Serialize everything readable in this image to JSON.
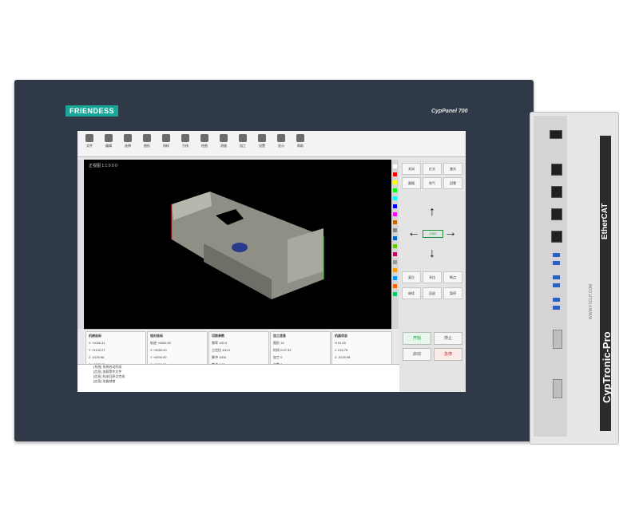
{
  "brand": "FRIENDESS",
  "model": "CypPanel 700",
  "toolbar": {
    "items": [
      "文件",
      "编辑",
      "选择",
      "图形",
      "排样",
      "引线",
      "绘图",
      "测量",
      "加工",
      "设置",
      "显示",
      "帮助"
    ]
  },
  "viewport": {
    "label": "正视图 1:1 0 0 0"
  },
  "right_panel": {
    "top": [
      "关闭",
      "红光",
      "激光",
      "跟随",
      "吹气",
      "回零"
    ],
    "speed": "1000",
    "mid": [
      "复位",
      "寻边",
      "断点",
      "继续",
      "回退",
      "暂停"
    ],
    "run_start": "开始",
    "run_stop": "停止",
    "run_other": [
      "启动",
      "急停"
    ]
  },
  "stats": [
    [
      "机械坐标",
      "X +0026.41",
      "Y +0132.27",
      "Z -0129.98",
      "B +0005.00"
    ],
    [
      "相对坐标",
      "轨迹 +0000.00",
      "X +0000.00",
      "Y +0000.00",
      "Z +0000.00"
    ],
    [
      "切割参数",
      "频率 100.0",
      "占空比 100.0",
      "脉冲 1000",
      "焦点 0.00"
    ],
    [
      "加工信息",
      "图形 15",
      "时间 0:07:32",
      "加工 0",
      "次数 0"
    ],
    [
      "机器状态",
      "H 01.00",
      "C 219.75",
      "Z -0129.98",
      "—"
    ]
  ],
  "log": [
    "[系统] 系统启动完成",
    "[信息] 加载零件文件",
    "[信息] 机床回原点完成",
    "[信息] 准备就绪"
  ],
  "ipc": {
    "ethercat": "EtherCAT",
    "name": "CypTronic-Pro",
    "site": "WWW.FSCUT.COM"
  },
  "colors": {
    "panel": "#2f3947",
    "accent": "#1aa79a",
    "ethercat": "#c62828"
  }
}
